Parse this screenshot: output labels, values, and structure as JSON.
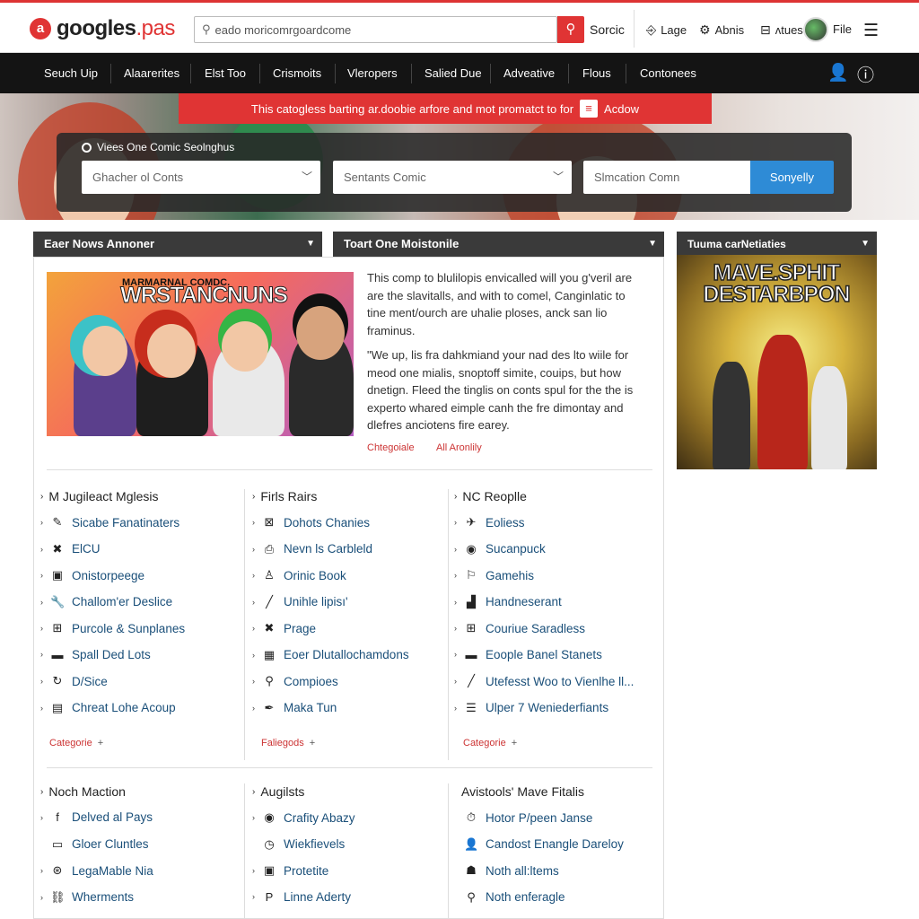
{
  "header": {
    "logo_mark": "a",
    "logo_name": "googles",
    "logo_tld": ".pas",
    "search_placeholder": "eado moricomrgoardcome",
    "search_label": "Sorcic",
    "links": [
      {
        "icon": "login-icon",
        "glyph": "⎆",
        "label": "Lage"
      },
      {
        "icon": "user-gear-icon",
        "glyph": "⚙",
        "label": "Abnis"
      },
      {
        "icon": "cart-icon",
        "glyph": "⊟",
        "label": "ʌtues"
      },
      {
        "icon": "file-icon",
        "glyph": "",
        "label": "File"
      }
    ]
  },
  "nav": {
    "items": [
      "Seuch Uip",
      "Alaarerites",
      "Elst Too",
      "Crismoits",
      "Vleropers",
      "Salied Due",
      "Adveative",
      "Flous",
      "Contonees"
    ],
    "icons": [
      {
        "name": "user-icon",
        "glyph": "👤"
      },
      {
        "name": "info-icon",
        "glyph": "ⓘ"
      }
    ]
  },
  "hero": {
    "banner_text": "This catogless barting ar.doobie arfore and mot promatct to for",
    "banner_action": "Acdow",
    "filter_title": "Viees One Comic Seolnghus",
    "select1": "Ghacher ol Conts",
    "select2": "Sentants Comic",
    "input3": "Slmcation Comn",
    "search_button": "Sonyelly"
  },
  "panels": {
    "left_title": "Eaer Nows Annoner",
    "mid_title": "Toart One Moistonile",
    "side_title": "Tuuma carNetiaties"
  },
  "feature": {
    "img_sub": "MARMARNAL COMDC.",
    "img_title": "WRSTANCNUNS",
    "para1": "This comp to  blulilopis envicalled will you g'veril are are the slavitalls, and with to comel, Canginlatic to tine ment/ourch are uhalie ploses, anck san lio framinus.",
    "para2": "\"We up, lis fra dahkmiand your nad des lto wiile for meod one mialis, snoptoff simite, couips, but how dnetign. Fleed the tinglis on conts spul for the the is experto whared eimple canh the fre dimontay and dlefres anciotens fire earey.",
    "meta1": "Chtegoiale",
    "meta2": "All Aronlily"
  },
  "sidebar_card": {
    "sub": "MAVE SPHIT",
    "title": "MAVE.SPHIT DESTARBPON"
  },
  "columns": [
    {
      "head": "M Jugileact Mglesis",
      "items": [
        {
          "icon": "spray-icon",
          "glyph": "✎",
          "label": "Sicabe Fanatinaters"
        },
        {
          "icon": "x-icon",
          "glyph": "✖",
          "label": "ElCU"
        },
        {
          "icon": "square-icon",
          "glyph": "▣",
          "label": "Onistorpeege"
        },
        {
          "icon": "wrench-icon",
          "glyph": "🔧",
          "label": "Challom'er Deslice"
        },
        {
          "icon": "gamepad-icon",
          "glyph": "⊞",
          "label": "Purcole & Sunplanes"
        },
        {
          "icon": "gun-icon",
          "glyph": "▬",
          "label": "Spall Ded Lots"
        },
        {
          "icon": "refresh-icon",
          "glyph": "↻",
          "label": "D/Sice"
        },
        {
          "icon": "book-icon",
          "glyph": "▤",
          "label": "Chreat Lohe Acoup"
        }
      ],
      "cat": "Categorie"
    },
    {
      "head": "Firls Rairs",
      "items": [
        {
          "icon": "archive-icon",
          "glyph": "⊠",
          "label": "Dohots Chanies"
        },
        {
          "icon": "printer-icon",
          "glyph": "⎙",
          "label": "Nevn ls Carbleld"
        },
        {
          "icon": "person-icon",
          "glyph": "♙",
          "label": "Orinic Book"
        },
        {
          "icon": "slash-icon",
          "glyph": "╱",
          "label": "Unihle lipisı'"
        },
        {
          "icon": "cross-icon",
          "glyph": "✖",
          "label": "Prage"
        },
        {
          "icon": "grid-icon",
          "glyph": "▦",
          "label": "Eoer Dlutallochamdons"
        },
        {
          "icon": "magnifier-icon",
          "glyph": "⚲",
          "label": "Compioes"
        },
        {
          "icon": "pen-icon",
          "glyph": "✒",
          "label": "Maka Tun"
        }
      ],
      "cat": "Faliegods"
    },
    {
      "head": "NC Reoplle",
      "items": [
        {
          "icon": "runner-icon",
          "glyph": "✈",
          "label": "Eoliess"
        },
        {
          "icon": "disc-icon",
          "glyph": "◉",
          "label": "Sucanpuck"
        },
        {
          "icon": "flag-icon",
          "glyph": "⚐",
          "label": "Gamehis"
        },
        {
          "icon": "chart-icon",
          "glyph": "▟",
          "label": "Handneserant"
        },
        {
          "icon": "gamepad-icon",
          "glyph": "⊞",
          "label": "Couriue Saradless"
        },
        {
          "icon": "gun-icon",
          "glyph": "▬",
          "label": "Eoople Banel Stanets"
        },
        {
          "icon": "pencil-icon",
          "glyph": "╱",
          "label": "Utefesst Woo to Vienlhe ll..."
        },
        {
          "icon": "list-icon",
          "glyph": "☰",
          "label": "Ulper 7 Weniederfiants"
        }
      ],
      "cat": "Categorie"
    }
  ],
  "columns2": [
    {
      "head": "Noch Maction",
      "items": [
        {
          "icon": "facebook-icon",
          "glyph": "f",
          "label": "Delved al Pays",
          "car": true
        },
        {
          "icon": "card-icon",
          "glyph": "▭",
          "label": "Gloer Cluntles",
          "car": false
        },
        {
          "icon": "gamepad-icon",
          "glyph": "⊛",
          "label": "LegaMable Nia",
          "car": true
        },
        {
          "icon": "chain-icon",
          "glyph": "⛓",
          "label": "Wherments",
          "car": true
        }
      ]
    },
    {
      "head": "Augilsts",
      "items": [
        {
          "icon": "target-icon",
          "glyph": "◉",
          "label": "Crafity Abazy",
          "car": true
        },
        {
          "icon": "clock-icon",
          "glyph": "◷",
          "label": "Wiekfievels",
          "car": false
        },
        {
          "icon": "frame-icon",
          "glyph": "▣",
          "label": "Protetite",
          "car": true
        },
        {
          "icon": "p-icon",
          "glyph": "P",
          "label": "Linne Aderty",
          "car": true
        }
      ]
    },
    {
      "head": "Avistools' Mave Fitalis",
      "items": [
        {
          "icon": "stopwatch-icon",
          "glyph": "⏱",
          "label": "Hotor P/peen Janse",
          "car": false
        },
        {
          "icon": "person-icon",
          "glyph": "👤",
          "label": "Candost Enangle Dareloy",
          "car": false
        },
        {
          "icon": "group-icon",
          "glyph": "☗",
          "label": "Noth all:ltems",
          "car": false
        },
        {
          "icon": "pin-icon",
          "glyph": "⚲",
          "label": "Noth enferagle",
          "car": false
        }
      ]
    }
  ]
}
